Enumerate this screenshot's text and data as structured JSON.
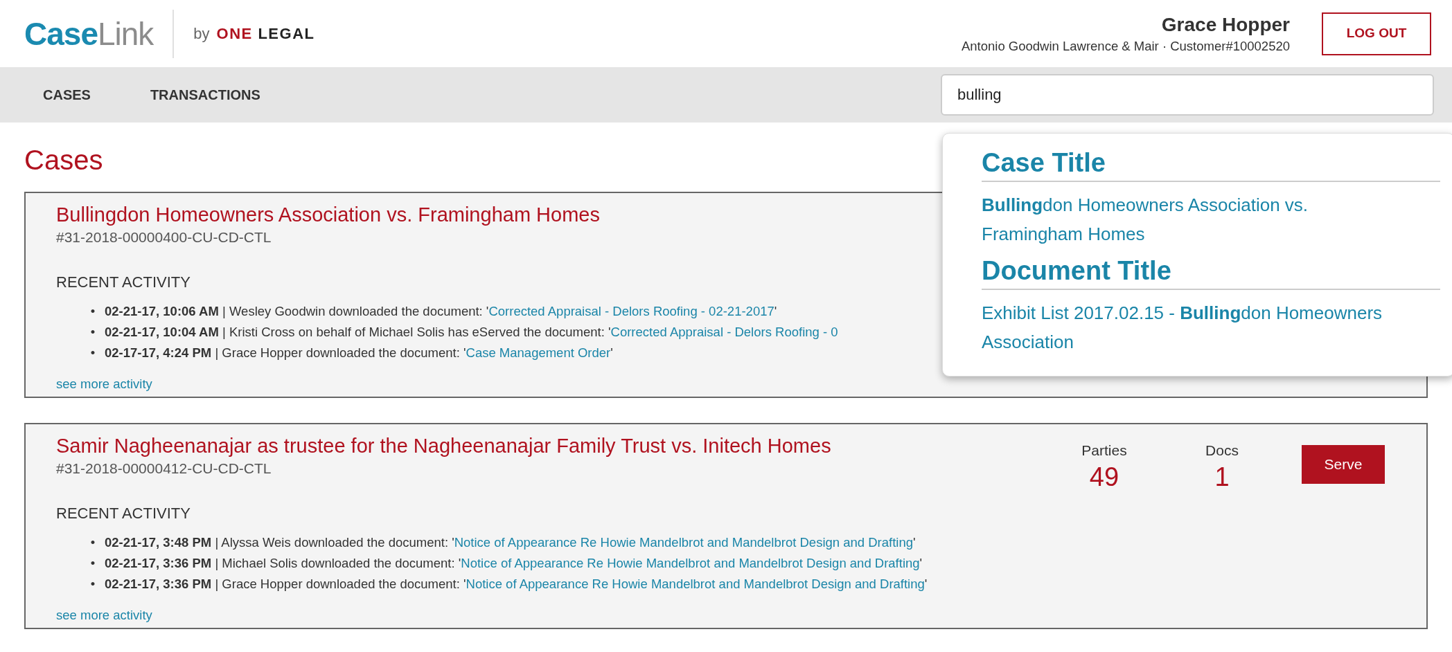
{
  "header": {
    "logo": {
      "primary": "Case",
      "secondary": "Link"
    },
    "byline": "by",
    "brand": [
      "ONE",
      "LEGAL"
    ],
    "user_name": "Grace Hopper",
    "account": "Antonio Goodwin Lawrence & Mair · Customer#10002520",
    "logout": "LOG OUT"
  },
  "nav": {
    "items": [
      {
        "label": "CASES"
      },
      {
        "label": "TRANSACTIONS"
      }
    ],
    "search": {
      "value": "bulling"
    }
  },
  "page_title": "Cases",
  "list_marker": "•",
  "cases": [
    {
      "title": "Bullingdon Homeowners Association vs. Framingham Homes",
      "number": "#31-2018-00000400-CU-CD-CTL",
      "activity_heading": "RECENT ACTIVITY",
      "activity": [
        {
          "time": "02-21-17, 10:06 AM",
          "text": " | Wesley Goodwin downloaded the document: '",
          "document": "Corrected Appraisal - Delors Roofing - 02-21-2017",
          "suffix": "'"
        },
        {
          "time": "02-21-17, 10:04 AM",
          "text": " | Kristi Cross on behalf of Michael Solis has eServed the document: '",
          "document": "Corrected Appraisal - Delors Roofing - 0"
        },
        {
          "time": "02-17-17, 4:24 PM",
          "text": " | Grace Hopper downloaded the document: '",
          "document": "Case Management Order",
          "suffix": "'"
        }
      ],
      "more": "see more activity"
    },
    {
      "title": "Samir Nagheenanajar as trustee for the Nagheenanajar Family Trust vs. Initech Homes",
      "number": "#31-2018-00000412-CU-CD-CTL",
      "stats": [
        {
          "label": "Parties",
          "value": "49"
        },
        {
          "label": "Docs",
          "value": "1"
        }
      ],
      "action": "Serve",
      "activity_heading": "RECENT ACTIVITY",
      "activity": [
        {
          "time": "02-21-17, 3:48 PM",
          "text": " | Alyssa Weis downloaded the document: '",
          "document": "Notice of Appearance Re Howie Mandelbrot and Mandelbrot Design and Drafting",
          "suffix": "'"
        },
        {
          "time": "02-21-17, 3:36 PM",
          "text": " | Michael Solis downloaded the document: '",
          "document": "Notice of Appearance Re Howie Mandelbrot and Mandelbrot Design and Drafting",
          "suffix": "'"
        },
        {
          "time": "02-21-17, 3:36 PM",
          "text": " | Grace Hopper downloaded the document: '",
          "document": "Notice of Appearance Re Howie Mandelbrot and Mandelbrot Design and Drafting",
          "suffix": "'"
        }
      ],
      "more": "see more activity"
    }
  ],
  "suggestions": {
    "groups": [
      {
        "heading": "Case Title",
        "items": [
          "**Bulling**don Homeowners Association vs. Framingham Homes"
        ]
      },
      {
        "heading": "Document Title",
        "items": [
          "Exhibit List 2017.02.15 - **Bulling**don Homeowners Association"
        ]
      }
    ]
  }
}
